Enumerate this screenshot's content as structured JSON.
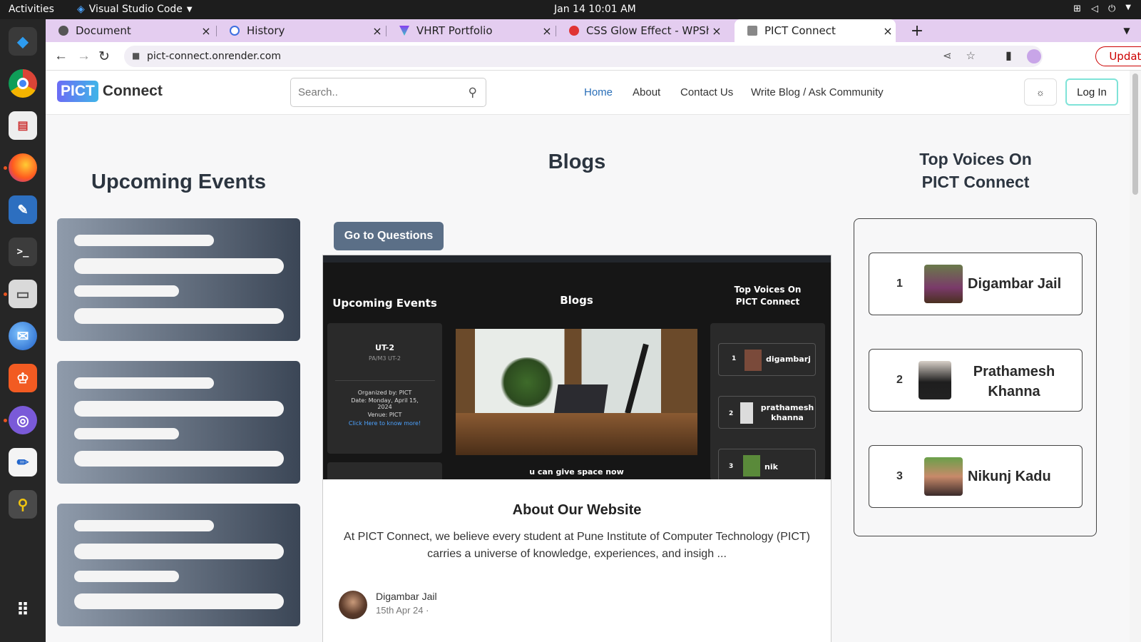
{
  "os": {
    "activities": "Activities",
    "app_name": "Visual Studio Code",
    "clock": "Jan 14  10:01 AM"
  },
  "dock": {
    "icons": [
      "vscode-icon",
      "chrome-icon",
      "document-viewer-icon",
      "firefox-icon",
      "writer-icon",
      "terminal-icon",
      "files-icon",
      "thunderbird-icon",
      "brave-icon",
      "network-icon",
      "text-editor-icon",
      "screenshot-icon",
      "app-grid-icon"
    ]
  },
  "browser": {
    "tabs": [
      {
        "title": "Document",
        "color": "#555555"
      },
      {
        "title": "History",
        "color": "#3d6fe0"
      },
      {
        "title": "VHRT Portfolio",
        "color": "#8a3cf0"
      },
      {
        "title": "CSS Glow Effect - WPShout",
        "color": "#e03434"
      },
      {
        "title": "PICT Connect",
        "color": "#777777"
      }
    ],
    "new_tab": "+",
    "url": "pict-connect.onrender.com",
    "update_label": "Update"
  },
  "site": {
    "logo_pict": "PICT",
    "logo_connect": "Connect",
    "search_placeholder": "Search..",
    "nav": [
      "Home",
      "About",
      "Contact Us",
      "Write Blog / Ask Community"
    ],
    "theme_toggle": "☼",
    "login": "Log In",
    "upcoming_title": "Upcoming Events",
    "blogs_title": "Blogs",
    "voices_title": "Top Voices On PICT Connect",
    "go_to_questions": "Go to Questions",
    "voices": [
      {
        "rank": "1",
        "name": "Digambar Jail"
      },
      {
        "rank": "2",
        "name": "Prathamesh Khanna"
      },
      {
        "rank": "3",
        "name": "Nikunj Kadu"
      }
    ]
  },
  "blog_card": {
    "preview": {
      "upcoming": "Upcoming Events",
      "blogs": "Blogs",
      "top_voices": "Top Voices On PICT Connect",
      "event_title": "UT-2",
      "event_sub": "PA/M3 UT-2",
      "organized": "Organized by: PICT",
      "date": "Date: Monday, April 15, 2024",
      "venue": "Venue: PICT",
      "more_link": "Click Here to know more!",
      "caption": "u can give space now",
      "voices": [
        {
          "rank": "1",
          "name": "digambarj"
        },
        {
          "rank": "2",
          "name": "prathamesh khanna"
        },
        {
          "rank": "3",
          "name": "nik"
        }
      ]
    },
    "title": "About Our Website",
    "excerpt": "At PICT Connect, we believe every student at Pune Institute of Computer Technology (PICT) carries a universe of knowledge, experiences, and insigh ...",
    "author": "Digambar Jail",
    "date": "15th Apr 24 ·"
  }
}
